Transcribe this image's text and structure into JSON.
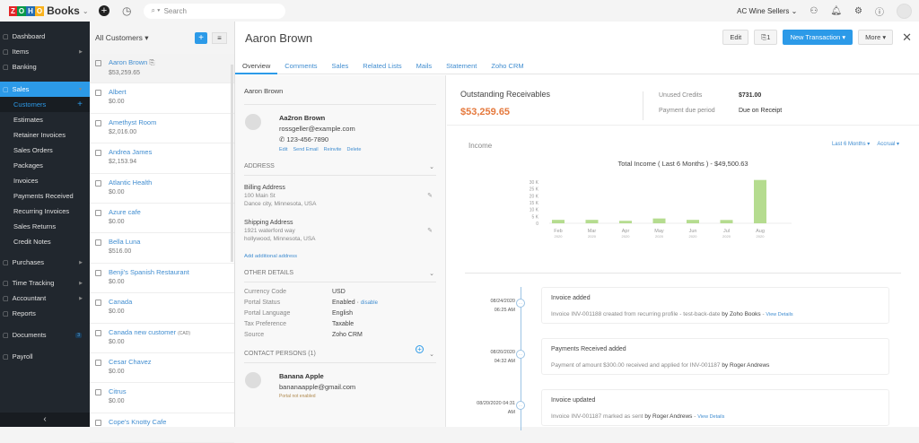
{
  "topbar": {
    "brand": "Books",
    "logo_letters": [
      "Z",
      "O",
      "H",
      "O"
    ],
    "search_placeholder": "Search",
    "org": "AC Wine Sellers"
  },
  "sidebar": {
    "items": [
      {
        "label": "Dashboard",
        "icon": "dashboard-icon",
        "type": "main"
      },
      {
        "label": "Items",
        "icon": "basket-icon",
        "type": "main",
        "arrow": true
      },
      {
        "label": "Banking",
        "icon": "bank-icon",
        "type": "main"
      },
      {
        "label": "Sales",
        "icon": "cart-icon",
        "type": "section",
        "arrow": true
      },
      {
        "label": "Customers",
        "type": "active-sub"
      },
      {
        "label": "Estimates",
        "type": "sub"
      },
      {
        "label": "Retainer Invoices",
        "type": "sub"
      },
      {
        "label": "Sales Orders",
        "type": "sub"
      },
      {
        "label": "Packages",
        "type": "sub"
      },
      {
        "label": "Invoices",
        "type": "sub"
      },
      {
        "label": "Payments Received",
        "type": "sub"
      },
      {
        "label": "Recurring Invoices",
        "type": "sub"
      },
      {
        "label": "Sales Returns",
        "type": "sub"
      },
      {
        "label": "Credit Notes",
        "type": "sub"
      },
      {
        "label": "Purchases",
        "icon": "bag-icon",
        "type": "main",
        "arrow": true
      },
      {
        "label": "Time Tracking",
        "icon": "stopwatch-icon",
        "type": "main",
        "arrow": true
      },
      {
        "label": "Accountant",
        "icon": "person-icon",
        "type": "main",
        "arrow": true
      },
      {
        "label": "Reports",
        "icon": "chart-icon",
        "type": "main"
      },
      {
        "label": "Documents",
        "icon": "folder-icon",
        "type": "main",
        "badge": "3"
      },
      {
        "label": "Payroll",
        "icon": "payroll-icon",
        "type": "main"
      }
    ]
  },
  "list": {
    "filter": "All Customers ▾",
    "customers": [
      {
        "name": "Aaron Brown",
        "amount": "$53,259.65",
        "attach": true
      },
      {
        "name": "Albert",
        "amount": "$0.00"
      },
      {
        "name": "Amethyst Room",
        "amount": "$2,016.00"
      },
      {
        "name": "Andrea James",
        "amount": "$2,153.94"
      },
      {
        "name": "Atlantic Health",
        "amount": "$0.00"
      },
      {
        "name": "Azure cafe",
        "amount": "$0.00"
      },
      {
        "name": "Bella Luna",
        "amount": "$516.00"
      },
      {
        "name": "Benji's Spanish Restaurant",
        "amount": "$0.00"
      },
      {
        "name": "Canada",
        "amount": "$0.00"
      },
      {
        "name": "Canada new customer",
        "currency": "(CAD)",
        "amount": "$0.00"
      },
      {
        "name": "Cesar Chavez",
        "amount": "$0.00"
      },
      {
        "name": "Citrus",
        "amount": "$0.00"
      },
      {
        "name": "Cope's Knotty Cafe",
        "amount": ""
      }
    ]
  },
  "detail": {
    "title": "Aaron Brown",
    "edit": "Edit",
    "attach": "1",
    "new_txn": "New Transaction ▾",
    "more": "More ▾",
    "tabs": [
      "Overview",
      "Comments",
      "Sales",
      "Related Lists",
      "Mails",
      "Statement",
      "Zoho CRM"
    ],
    "display_name": "Aaron Brown",
    "contact": {
      "name": "Aa2ron Brown",
      "email": "rossgeller@example.com",
      "phone": "123-456-7890",
      "links": [
        "Edit",
        "Send Email",
        "Reinvite",
        "Delete"
      ]
    },
    "address_header": "ADDRESS",
    "billing": {
      "title": "Billing Address",
      "line1": "100 Main St",
      "line2": "Dance city, Minnesota, USA"
    },
    "shipping": {
      "title": "Shipping Address",
      "line1": "1921 waterford way",
      "line2": "hollywood, Minnesota, USA"
    },
    "add_address": "Add additional address",
    "other_header": "OTHER DETAILS",
    "other": [
      {
        "k": "Currency Code",
        "v": "USD"
      },
      {
        "k": "Portal Status",
        "v": "Enabled · ",
        "link": "disable"
      },
      {
        "k": "Portal Language",
        "v": "English"
      },
      {
        "k": "Tax Preference",
        "v": "Taxable"
      },
      {
        "k": "Source",
        "v": "Zoho CRM"
      }
    ],
    "contacts_header": "CONTACT PERSONS (1)",
    "person": {
      "name": "Banana Apple",
      "email": "bananaapple@gmail.com",
      "status": "Portal not enabled"
    },
    "receivables_label": "Outstanding Receivables",
    "receivables": "$53,259.65",
    "unused_credits_label": "Unused Credits",
    "unused_credits": "$731.00",
    "due_label": "Payment due period",
    "due": "Due on Receipt",
    "income_label": "Income",
    "period": "Last 6 Months ▾",
    "basis": "Accrual ▾",
    "timeline": [
      {
        "date": "08/24/2020",
        "time": "06:25 AM",
        "title": "Invoice added",
        "desc": "Invoice INV-001188 created from recurring profile - test-back-date ",
        "by": "by Zoho Books",
        "link": "View Details"
      },
      {
        "date": "08/20/2020",
        "time": "04:32 AM",
        "title": "Payments Received added",
        "desc": "Payment of amount $300.00 received and applied for INV-001187 ",
        "by": "by Roger Andrews",
        "link": ""
      },
      {
        "date": "08/20/2020 04:31",
        "time": "AM",
        "title": "Invoice updated",
        "desc": "Invoice INV-001187 marked as sent ",
        "by": "by Roger Andrews",
        "link": "View Details"
      }
    ]
  },
  "chart_data": {
    "type": "bar",
    "title": "Total Income ( Last 6 Months ) - $49,500.63",
    "categories": [
      "Feb",
      "Mar",
      "Apr",
      "May",
      "Jun",
      "Jul",
      "Aug"
    ],
    "sublabels": [
      "2020",
      "2020",
      "2020",
      "2020",
      "2020",
      "2020",
      "2020"
    ],
    "values": [
      2500,
      2500,
      1800,
      3500,
      2500,
      2400,
      31500
    ],
    "yticks": [
      "0",
      "5 K",
      "10 K",
      "15 K",
      "20 K",
      "25 K",
      "30 K"
    ],
    "ylim": [
      0,
      30000
    ],
    "color": "#b5dc8f"
  }
}
